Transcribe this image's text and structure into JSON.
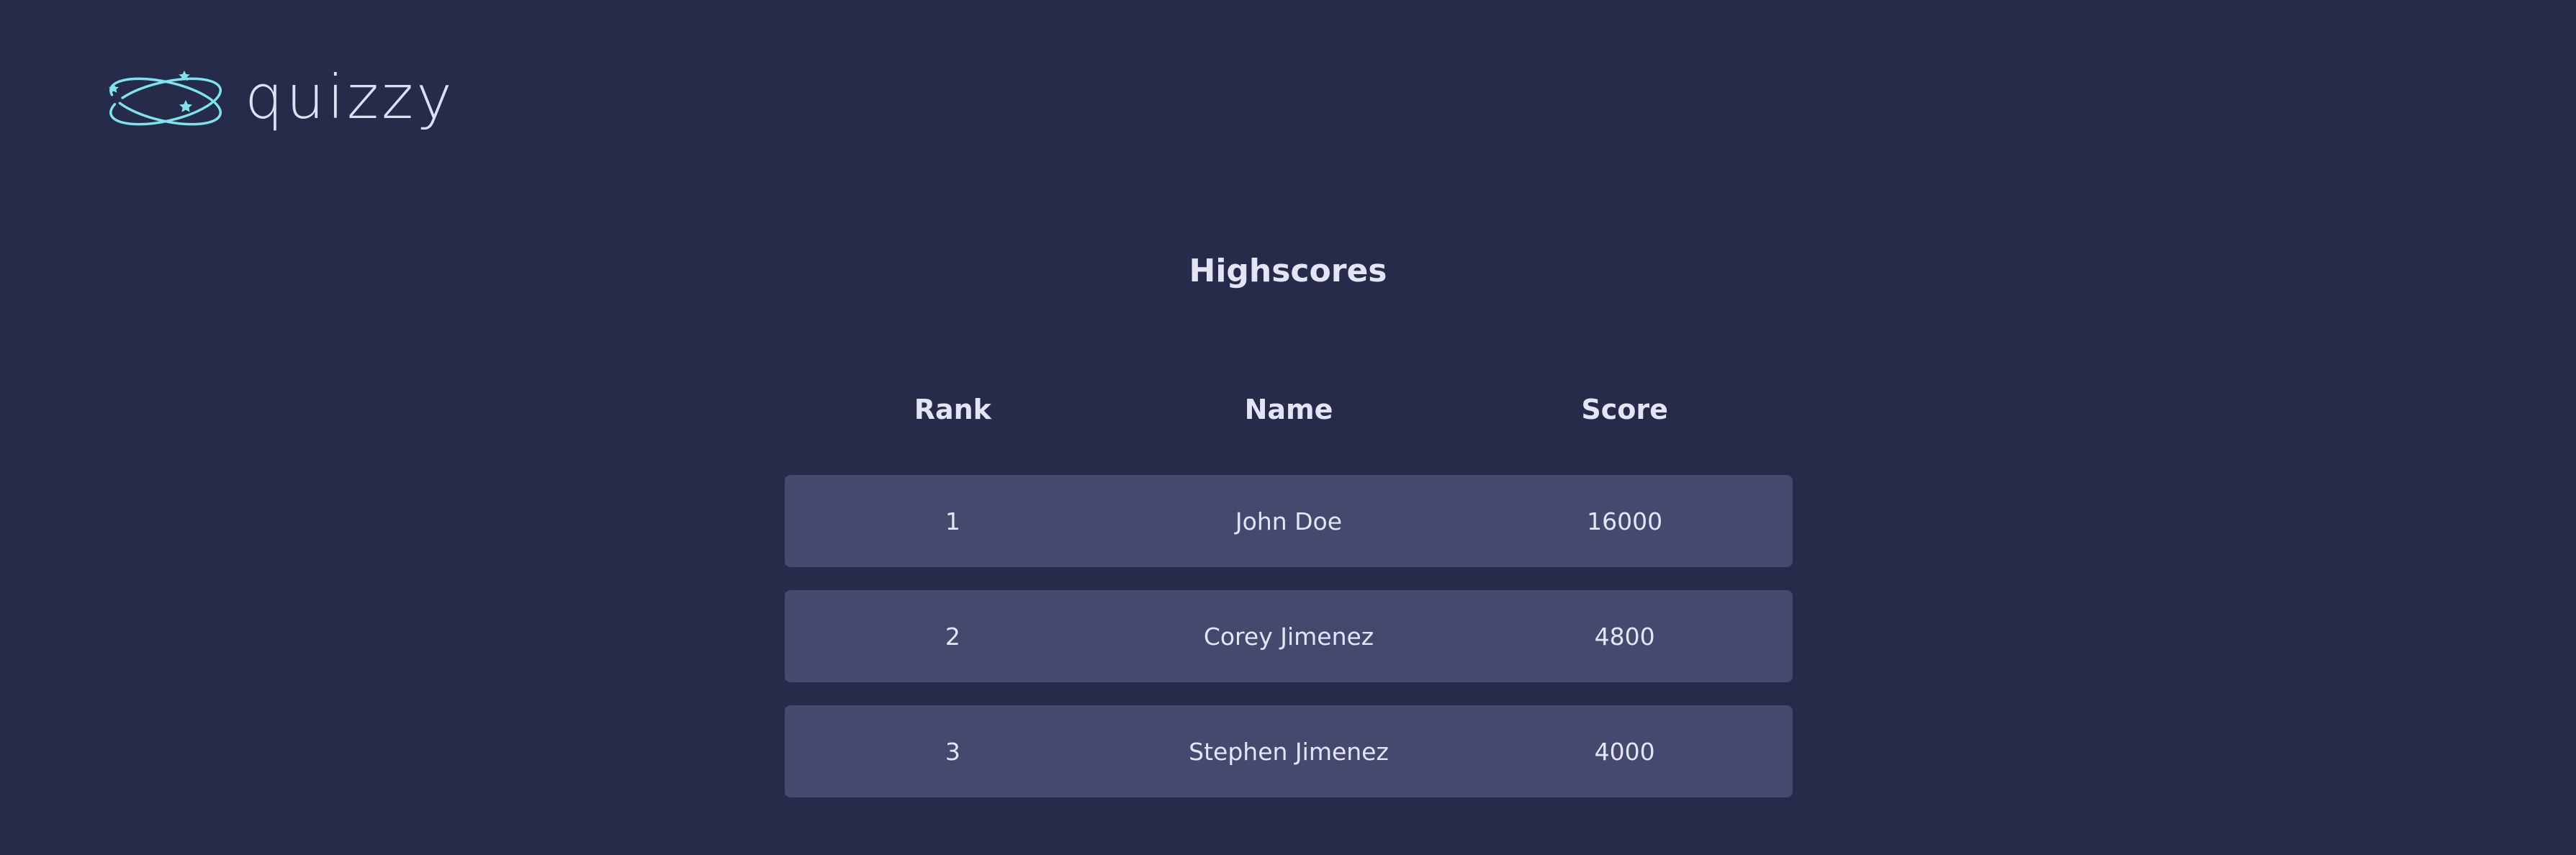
{
  "app": {
    "logo_text": "quizzy",
    "logo_icon": "orbit-stars-icon",
    "accent_color": "#7fe3ee"
  },
  "page": {
    "title": "Highscores"
  },
  "table": {
    "headers": {
      "rank": "Rank",
      "name": "Name",
      "score": "Score"
    },
    "rows": [
      {
        "rank": "1",
        "name": "John Doe",
        "score": "16000"
      },
      {
        "rank": "2",
        "name": "Corey Jimenez",
        "score": "4800"
      },
      {
        "rank": "3",
        "name": "Stephen Jimenez",
        "score": "4000"
      }
    ]
  }
}
